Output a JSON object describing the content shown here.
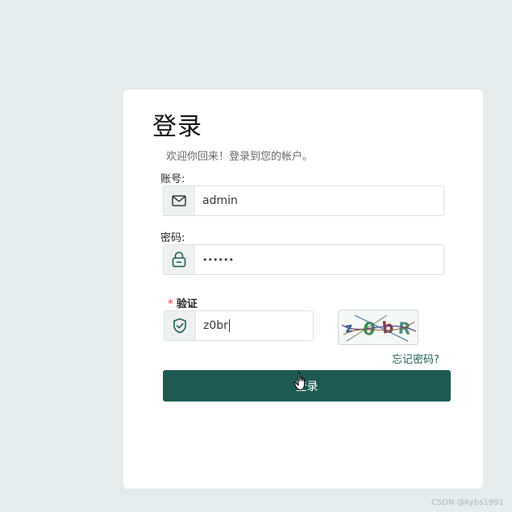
{
  "login": {
    "title": "登录",
    "subtitle": "欢迎你回来！登录到您的帐户。",
    "username": {
      "label": "账号:",
      "value": "admin",
      "icon": "envelope-icon"
    },
    "password": {
      "label": "密码:",
      "value": "••••••",
      "icon": "lock-icon"
    },
    "captcha": {
      "required_mark": "*",
      "label": "验证",
      "value": "z0br",
      "icon": "shield-icon",
      "image_text": "z0bR"
    },
    "forgot_link": "忘记密码?",
    "submit_label": "登录"
  },
  "colors": {
    "page_bg": "#e6eceb",
    "primary": "#1e5a52",
    "link": "#1f5a52",
    "required": "#f56c6c"
  },
  "watermark": "CSDN @kybs1991"
}
